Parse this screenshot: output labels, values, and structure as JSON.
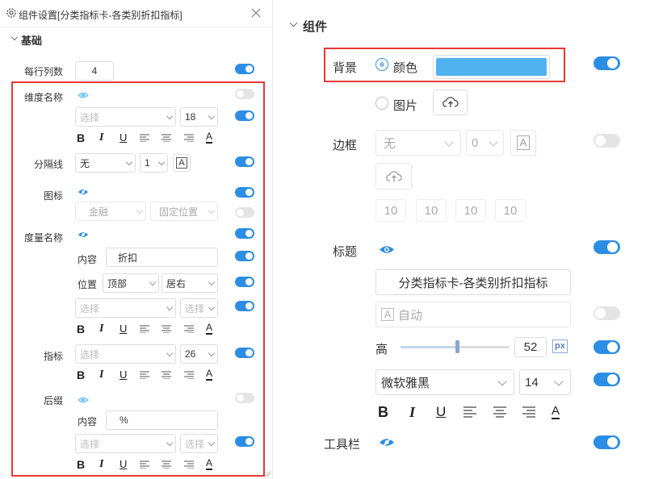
{
  "left": {
    "header_title": "组件设置[分类指标卡-各类别折扣指标]",
    "section": "基础",
    "per_row_label": "每行列数",
    "per_row_value": "4",
    "dim_name": {
      "label": "维度名称",
      "font_placeholder": "选择",
      "font_size": "18"
    },
    "separator": {
      "label": "分隔线",
      "style": "无",
      "width": "1",
      "a_glyph": "A"
    },
    "icon": {
      "label": "图标",
      "type": "金融",
      "position": "固定位置"
    },
    "metric_name": {
      "label": "度量名称",
      "content_label": "内容",
      "content_value": "折扣",
      "position_label": "位置",
      "position_value": "顶部",
      "align_value": "居右",
      "font_placeholder": "选择",
      "weight_placeholder": "选择"
    },
    "indicator": {
      "label": "指标",
      "font_placeholder": "选择",
      "font_size": "26"
    },
    "suffix": {
      "label": "后缀",
      "content_label": "内容",
      "content_value": "%",
      "font_placeholder": "选择",
      "weight_placeholder": "选择"
    },
    "fmt": {
      "bold": "B",
      "italic": "I",
      "underline": "U",
      "color": "A"
    }
  },
  "right": {
    "section": "组件",
    "background": {
      "label": "背景",
      "color_option": "颜色",
      "image_option": "图片",
      "color_value": "#4fb3ef"
    },
    "border": {
      "label": "边框",
      "style": "无",
      "width": "0",
      "a_glyph": "A",
      "radius": [
        "10",
        "10",
        "10",
        "10"
      ]
    },
    "title": {
      "label": "标题",
      "text": "分类指标卡-各类别折扣指标",
      "auto_label": "自动",
      "height_label": "高",
      "height_value": "52",
      "unit": "px",
      "font": "微软雅黑",
      "font_size": "14"
    },
    "toolbar": {
      "label": "工具栏"
    },
    "fmt": {
      "bold": "B",
      "italic": "I",
      "underline": "U",
      "color": "A"
    }
  },
  "colors": {
    "accent": "#2c8de4",
    "highlight": "#e53935",
    "swatch": "#4fb3ef"
  }
}
